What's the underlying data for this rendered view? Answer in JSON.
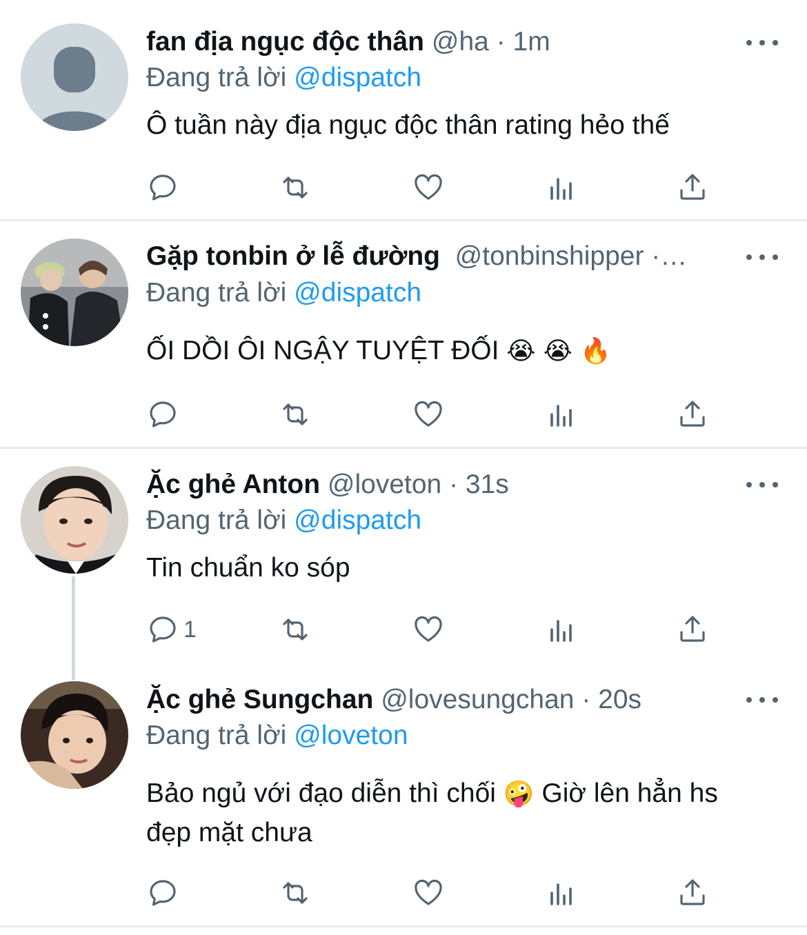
{
  "colors": {
    "accent": "#1d9bf0",
    "secondary_text": "#536471",
    "primary_text": "#0f1419",
    "divider": "#e6ecf0"
  },
  "tweets": [
    {
      "display_name": "fan địa ngục độc thân",
      "handle": "@ha",
      "separator": " · ",
      "time": "1m",
      "reply_prefix": "Đang trả lời ",
      "reply_to": "@dispatch",
      "text": "Ô tuần này địa ngục độc thân rating hẻo thế",
      "reply_count": "",
      "avatar": "default-avatar-icon"
    },
    {
      "display_name": "Gặp tonbin ở lễ đường",
      "handle": "@tonbinshipper",
      "separator": " ·…",
      "time": "",
      "reply_prefix": "Đang trả lời ",
      "reply_to": "@dispatch",
      "text": "ỐI DỒI ÔI NGẬY TUYỆT ĐỐI",
      "emojis": "😭 😭 🔥",
      "reply_count": "",
      "avatar": "photo-two-people"
    },
    {
      "display_name": "Ặc ghẻ Anton",
      "handle": "@loveton",
      "separator": " · ",
      "time": "31s",
      "reply_prefix": "Đang trả lời ",
      "reply_to": "@dispatch",
      "text": "Tin chuẩn ko sóp",
      "reply_count": "1",
      "avatar": "photo-boy-suit"
    },
    {
      "display_name": "Ặc ghẻ Sungchan",
      "handle": "@lovesungchan",
      "separator": " · ",
      "time": "20s",
      "reply_prefix": "Đang trả lời ",
      "reply_to": "@loveton",
      "text_part1": "Bảo ngủ với đạo diễn thì chối ",
      "emoji_mid": "🤪",
      "text_part2": "  Giờ lên hẳn hs đẹp mặt chưa",
      "reply_count": "",
      "avatar": "photo-child"
    }
  ],
  "action_icons": [
    "reply-icon",
    "retweet-icon",
    "like-icon",
    "views-icon",
    "share-icon"
  ]
}
